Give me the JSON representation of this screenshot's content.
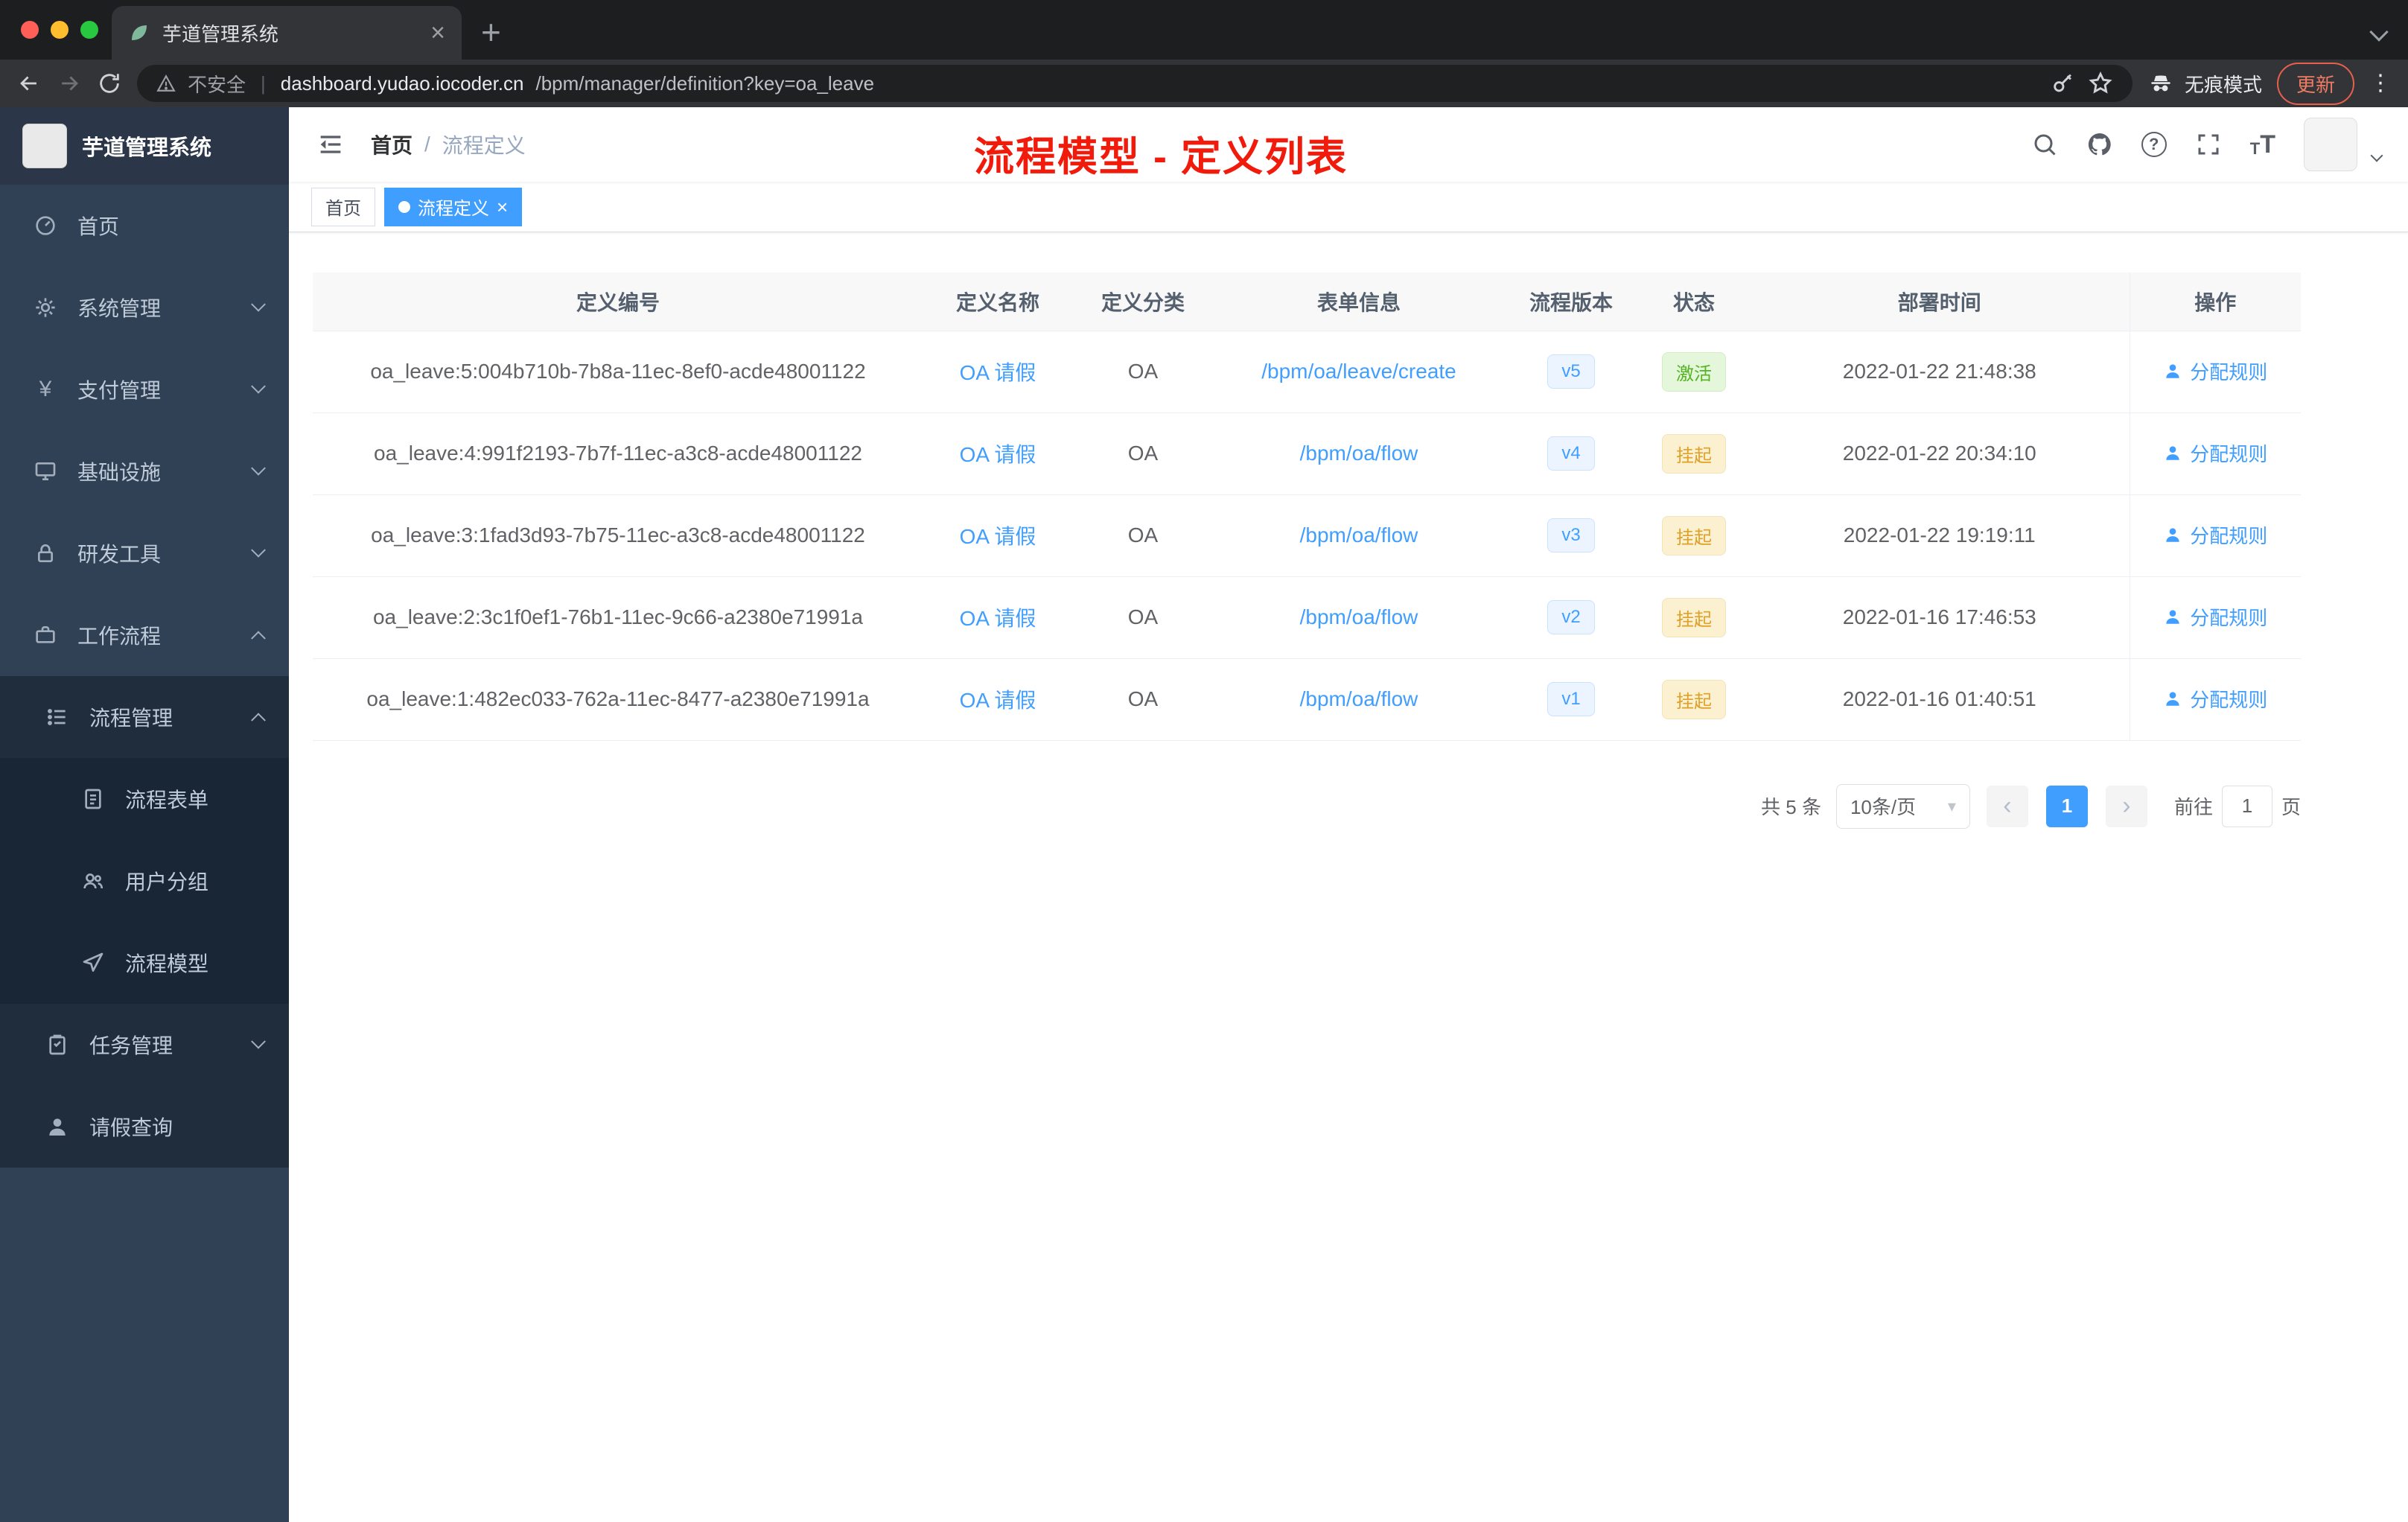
{
  "browser": {
    "tab_title": "芋道管理系统",
    "security_label": "不安全",
    "url_host": "dashboard.yudao.iocoder.cn",
    "url_path": "/bpm/manager/definition?key=oa_leave",
    "incognito_label": "无痕模式",
    "update_label": "更新"
  },
  "sidebar": {
    "logo_title": "芋道管理系统",
    "items": [
      {
        "label": "首页"
      },
      {
        "label": "系统管理"
      },
      {
        "label": "支付管理"
      },
      {
        "label": "基础设施"
      },
      {
        "label": "研发工具"
      },
      {
        "label": "工作流程"
      },
      {
        "label": "流程管理"
      },
      {
        "label": "流程表单"
      },
      {
        "label": "用户分组"
      },
      {
        "label": "流程模型"
      },
      {
        "label": "任务管理"
      },
      {
        "label": "请假查询"
      }
    ]
  },
  "header": {
    "breadcrumb_home": "首页",
    "breadcrumb_separator": "/",
    "breadcrumb_current": "流程定义",
    "annotation": "流程模型 - 定义列表"
  },
  "tags": {
    "home_label": "首页",
    "active_label": "流程定义"
  },
  "table": {
    "columns": [
      "定义编号",
      "定义名称",
      "定义分类",
      "表单信息",
      "流程版本",
      "状态",
      "部署时间",
      "操作"
    ],
    "rows": [
      {
        "id": "oa_leave:5:004b710b-7b8a-11ec-8ef0-acde48001122",
        "name": "OA 请假",
        "category": "OA",
        "form": "/bpm/oa/leave/create",
        "version": "v5",
        "status": "激活",
        "status_class": "status-tag success",
        "time": "2022-01-22 21:48:38",
        "action": "分配规则"
      },
      {
        "id": "oa_leave:4:991f2193-7b7f-11ec-a3c8-acde48001122",
        "name": "OA 请假",
        "category": "OA",
        "form": "/bpm/oa/flow",
        "version": "v4",
        "status": "挂起",
        "status_class": "status-tag warning",
        "time": "2022-01-22 20:34:10",
        "action": "分配规则"
      },
      {
        "id": "oa_leave:3:1fad3d93-7b75-11ec-a3c8-acde48001122",
        "name": "OA 请假",
        "category": "OA",
        "form": "/bpm/oa/flow",
        "version": "v3",
        "status": "挂起",
        "status_class": "status-tag warning",
        "time": "2022-01-22 19:19:11",
        "action": "分配规则"
      },
      {
        "id": "oa_leave:2:3c1f0ef1-76b1-11ec-9c66-a2380e71991a",
        "name": "OA 请假",
        "category": "OA",
        "form": "/bpm/oa/flow",
        "version": "v2",
        "status": "挂起",
        "status_class": "status-tag warning",
        "time": "2022-01-16 17:46:53",
        "action": "分配规则"
      },
      {
        "id": "oa_leave:1:482ec033-762a-11ec-8477-a2380e71991a",
        "name": "OA 请假",
        "category": "OA",
        "form": "/bpm/oa/flow",
        "version": "v1",
        "status": "挂起",
        "status_class": "status-tag warning",
        "time": "2022-01-16 01:40:51",
        "action": "分配规则"
      }
    ]
  },
  "pagination": {
    "total": "共 5 条",
    "page_size": "10条/页",
    "page": "1",
    "goto_prefix": "前往",
    "goto_value": "1",
    "goto_suffix": "页"
  },
  "colors": {
    "accent": "#409eff",
    "success": "#53b322",
    "warning": "#dfa129",
    "annotation_red": "#f11b0c",
    "sidebar_bg": "#304156"
  }
}
